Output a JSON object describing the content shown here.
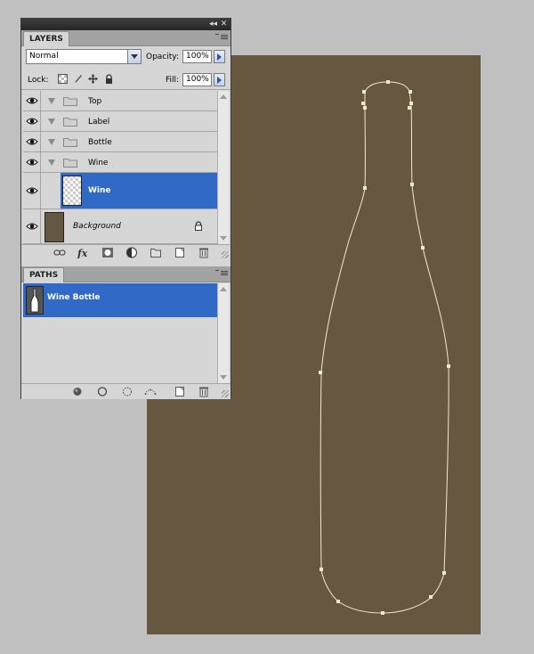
{
  "layers_panel": {
    "tab": "LAYERS",
    "blend_mode": "Normal",
    "opacity_label": "Opacity:",
    "opacity_value": "100%",
    "lock_label": "Lock:",
    "fill_label": "Fill:",
    "fill_value": "100%",
    "layers": [
      {
        "name": "Top",
        "type": "group",
        "visible": true
      },
      {
        "name": "Label",
        "type": "group",
        "visible": true
      },
      {
        "name": "Bottle",
        "type": "group",
        "visible": true
      },
      {
        "name": "Wine",
        "type": "group",
        "visible": true
      },
      {
        "name": "Wine",
        "type": "layer",
        "visible": true,
        "selected": true
      },
      {
        "name": "Background",
        "type": "background",
        "visible": true,
        "locked": true
      }
    ],
    "footer_icons": [
      "link-icon",
      "fx-icon",
      "mask-icon",
      "adjustment-icon",
      "new-group-icon",
      "new-layer-icon",
      "trash-icon"
    ]
  },
  "paths_panel": {
    "tab": "PATHS",
    "paths": [
      {
        "name": "Wine Bottle",
        "selected": true
      }
    ],
    "footer_icons": [
      "fill-path-icon",
      "stroke-path-icon",
      "load-selection-icon",
      "make-work-path-icon",
      "new-path-icon",
      "trash-icon"
    ]
  },
  "canvas": {
    "background_color": "#665741",
    "path_color": "#f2e8c8"
  },
  "colors": {
    "selection": "#3169c6",
    "panel": "#d6d6d6",
    "workspace": "#c0c0c0"
  }
}
